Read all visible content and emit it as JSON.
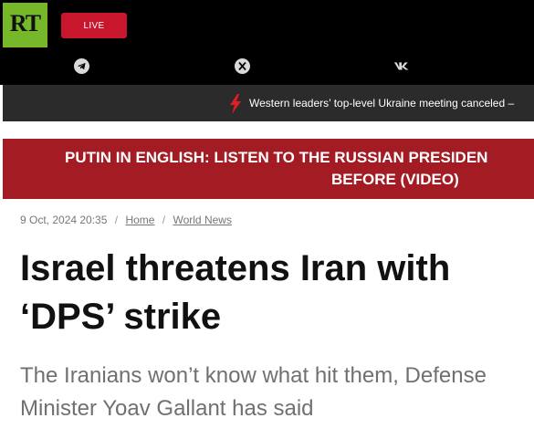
{
  "header": {
    "logo_text": "RT",
    "live_label": "LIVE",
    "social_icons": [
      "telegram-icon",
      "x-icon",
      "vk-icon"
    ],
    "colors": {
      "header_bg": "#000000",
      "logo_bg": "#77b82a",
      "live_bg": "#c8162d"
    }
  },
  "ticker": {
    "text": "Western leaders’ top-level Ukraine meeting canceled –",
    "icon": "lightning-bolt-icon",
    "bolt_color": "#e01e26"
  },
  "promo": {
    "line1": "PUTIN IN ENGLISH: LISTEN TO THE RUSSIAN PRESIDEN",
    "line2": "BEFORE (VIDEO)",
    "bg_color": "#a31c24"
  },
  "article": {
    "date": "9 Oct, 2024 20:35",
    "separator": "/",
    "breadcrumbs": [
      "Home",
      "World News"
    ],
    "title": "Israel threatens Iran with ‘DPS’ strike",
    "summary": "The Iranians won’t know what hit them, Defense Minister Yoav Gallant has said"
  }
}
